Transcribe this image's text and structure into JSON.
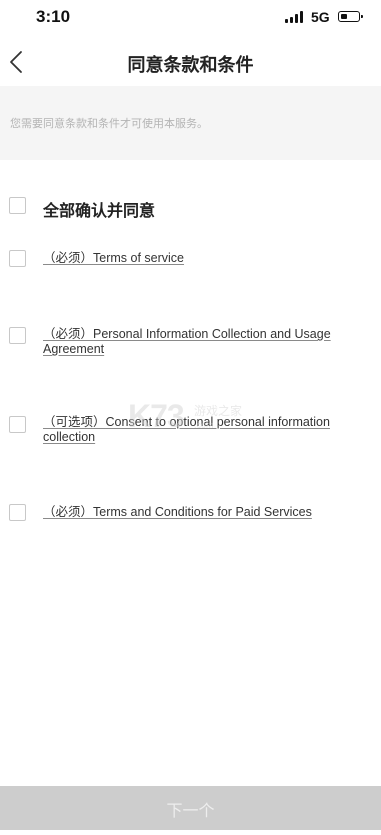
{
  "status_bar": {
    "time": "3:10",
    "network": "5G",
    "signal_icon": "signal-bars-icon",
    "battery_icon": "battery-icon",
    "battery_level": 0.25
  },
  "nav": {
    "back_icon": "chevron-left-icon",
    "title": "同意条款和条件"
  },
  "notice": {
    "text": "您需要同意条款和条件才可使用本服务。"
  },
  "agree_all": {
    "label": "全部确认并同意",
    "checked": false
  },
  "terms": [
    {
      "tag": "（必须）",
      "label": "Terms of service",
      "checked": false
    },
    {
      "tag": "（必须）",
      "label": "Personal Information Collection and Usage Agreement",
      "checked": false
    },
    {
      "tag": "（可选项）",
      "label": "Consent to optional personal information collection",
      "checked": false
    },
    {
      "tag": "（必须）",
      "label": "Terms and Conditions for Paid Services",
      "checked": false
    }
  ],
  "watermark": {
    "logo": "K73",
    "name": "游戏之家",
    "url": ".com"
  },
  "footer": {
    "next_label": "下一个"
  },
  "colors": {
    "notice_bg": "#f5f5f5",
    "notice_text": "#b4b4b4",
    "next_button_bg": "#cdcdcd",
    "next_button_text": "#eeeeee"
  }
}
